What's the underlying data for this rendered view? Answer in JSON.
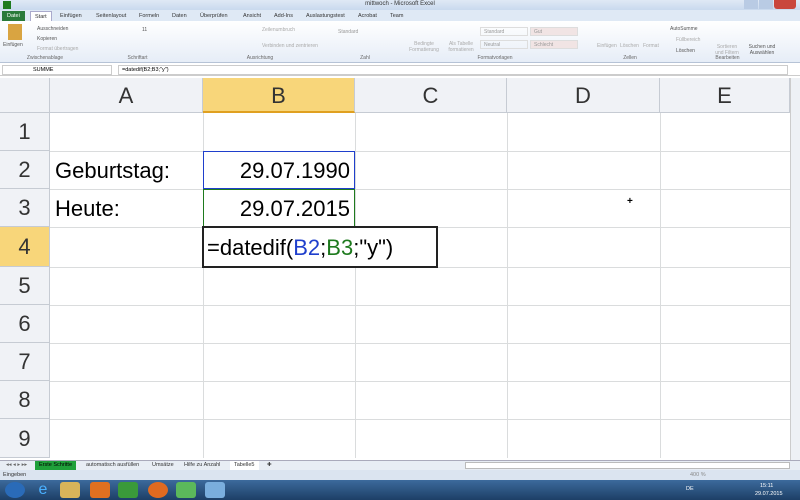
{
  "window": {
    "title": "mittwoch - Microsoft Excel"
  },
  "ribbon_tabs": [
    "Datei",
    "Start",
    "Einfügen",
    "Seitenlayout",
    "Formeln",
    "Daten",
    "Überprüfen",
    "Ansicht",
    "Add-Ins",
    "Auslastungstest",
    "Acrobat",
    "Team"
  ],
  "ribbon": {
    "clipboard": {
      "paste": "Einfügen",
      "cut": "Ausschneiden",
      "copy": "Kopieren",
      "format_painter": "Format übertragen",
      "group": "Zwischenablage"
    },
    "font": {
      "size": "11",
      "group": "Schriftart"
    },
    "alignment": {
      "wrap": "Zeilenumbruch",
      "merge": "Verbinden und zentrieren",
      "group": "Ausrichtung"
    },
    "number": {
      "format": "Standard",
      "group": "Zahl"
    },
    "styles": {
      "conditional": "Bedingte Formatierung",
      "table": "Als Tabelle formatieren",
      "standard": "Standard",
      "gut": "Gut",
      "neutral": "Neutral",
      "schlecht": "Schlecht",
      "group": "Formatvorlagen"
    },
    "cells": {
      "insert": "Einfügen",
      "delete": "Löschen",
      "format": "Format",
      "group": "Zellen"
    },
    "editing": {
      "autosum": "AutoSumme",
      "fill": "Füllbereich",
      "clear": "Löschen",
      "sort": "Sortieren und Filtern",
      "find": "Suchen und Auswählen",
      "group": "Bearbeiten"
    }
  },
  "formula_bar": {
    "name_box": "SUMME",
    "formula": "=datedif(B2;B3;\"y\")"
  },
  "columns": [
    "A",
    "B",
    "C",
    "D",
    "E"
  ],
  "rows": [
    "1",
    "2",
    "3",
    "4",
    "5",
    "6",
    "7",
    "8",
    "9"
  ],
  "cells": {
    "A2": "Geburtstag:",
    "B2": "29.07.1990",
    "A3": "Heute:",
    "B3": "29.07.2015",
    "B4_parts": {
      "p1": "=datedif(",
      "p2": "B2",
      "p3": ";",
      "p4": "B3",
      "p5": ";\"y\")"
    }
  },
  "sheets": [
    "Erste Schritte",
    "automatisch ausfüllen",
    "Umsätze",
    "Hilfe zu Anzahl",
    "Tabelle5"
  ],
  "status": {
    "mode": "Eingeben",
    "zoom": "400 %"
  },
  "taskbar": {
    "lang": "DE",
    "time": "15:11",
    "date": "29.07.2015"
  },
  "colors": {
    "ref1": "#1f3fcc",
    "ref2": "#1e7a1e",
    "accent": "#f8d67a"
  }
}
